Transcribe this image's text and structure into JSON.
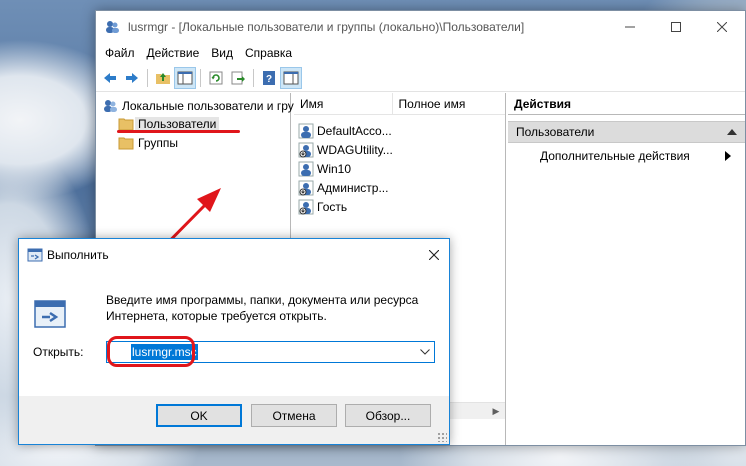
{
  "mmc": {
    "title": "lusrmgr - [Локальные пользователи и группы (локально)\\Пользователи]",
    "menu": [
      "Файл",
      "Действие",
      "Вид",
      "Справка"
    ],
    "tree": {
      "root": "Локальные пользователи и гру",
      "items": [
        "Пользователи",
        "Группы"
      ],
      "selected": "Пользователи"
    },
    "list": {
      "columns": [
        "Имя",
        "Полное имя"
      ],
      "rows": [
        "DefaultAcco...",
        "WDAGUtility...",
        "Win10",
        "Администр...",
        "Гость"
      ]
    },
    "actions": {
      "header": "Действия",
      "section": "Пользователи",
      "item": "Дополнительные действия"
    }
  },
  "run": {
    "title": "Выполнить",
    "description": "Введите имя программы, папки, документа или ресурса Интернета, которые требуется открыть.",
    "open_label": "Открыть:",
    "open_value": "lusrmgr.msc",
    "buttons": {
      "ok": "OK",
      "cancel": "Отмена",
      "browse": "Обзор..."
    }
  },
  "colors": {
    "accent": "#0078d7",
    "annotation_red": "#e0161b"
  }
}
